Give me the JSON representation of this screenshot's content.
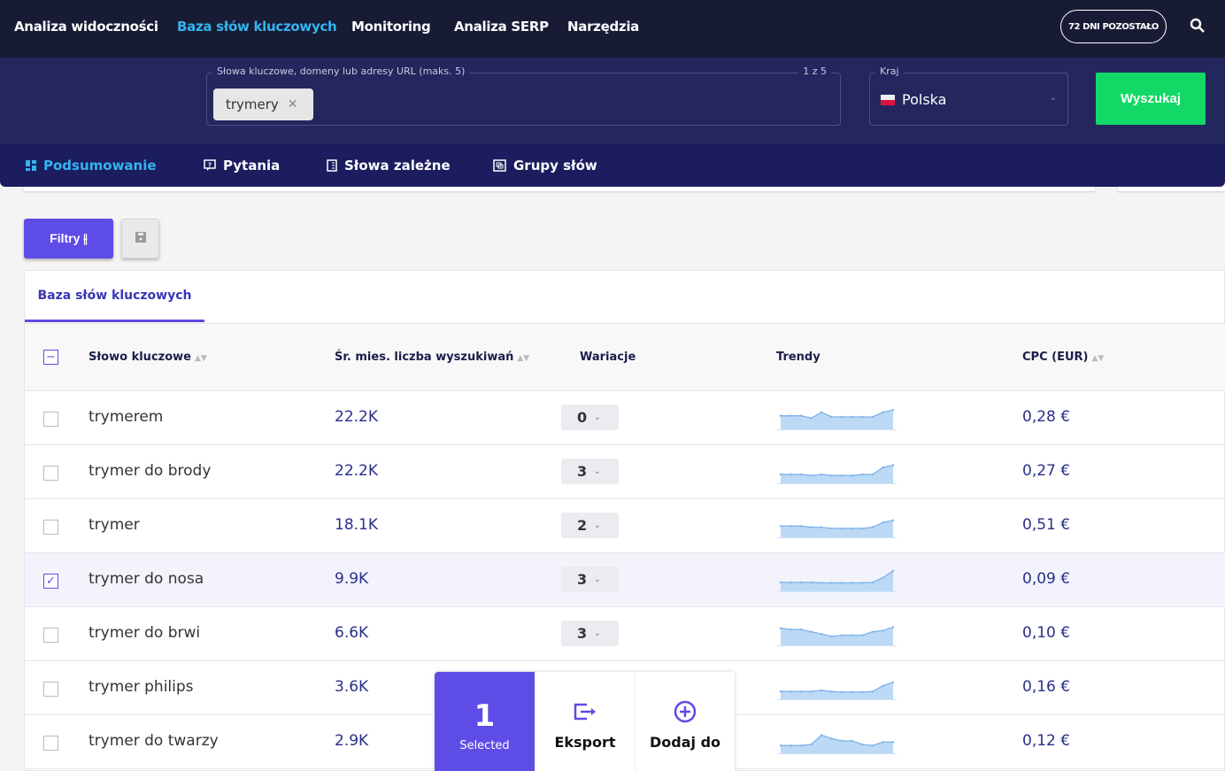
{
  "nav": {
    "items": [
      "Analiza widoczności",
      "Baza słów kluczowych",
      "Monitoring",
      "Analiza SERP",
      "Narzędzia"
    ],
    "active": 1,
    "days_badge": "72 DNI POZOSTAŁO"
  },
  "search": {
    "label": "Słowa kluczowe, domeny lub adresy URL (maks. 5)",
    "counter": "1 z 5",
    "chip": "trymery",
    "country_label": "Kraj",
    "country": "Polska",
    "button": "Wyszukaj"
  },
  "tabs": [
    {
      "label": "Podsumowanie",
      "icon": "dashboard-icon"
    },
    {
      "label": "Pytania",
      "icon": "question-icon"
    },
    {
      "label": "Słowa zależne",
      "icon": "document-icon"
    },
    {
      "label": "Grupy słów",
      "icon": "group-icon"
    }
  ],
  "toolbar": {
    "filters": "Filtry"
  },
  "card_tab": "Baza słów kluczowych",
  "columns": [
    "Słowo kluczowe",
    "Śr. mies. liczba wyszukiwań",
    "Wariacje",
    "Trendy",
    "CPC (EUR)"
  ],
  "rows": [
    {
      "keyword": "trymerem",
      "volume": "22.2K",
      "variations": "0",
      "cpc": "0,28 €",
      "selected": false,
      "trend": [
        55,
        55,
        55,
        45,
        70,
        50,
        50,
        50,
        50,
        50,
        70,
        80
      ]
    },
    {
      "keyword": "trymer do brody",
      "volume": "22.2K",
      "variations": "3",
      "cpc": "0,27 €",
      "selected": false,
      "trend": [
        35,
        35,
        35,
        30,
        35,
        30,
        30,
        30,
        35,
        35,
        65,
        75
      ]
    },
    {
      "keyword": "trymer",
      "volume": "18.1K",
      "variations": "2",
      "cpc": "0,51 €",
      "selected": false,
      "trend": [
        45,
        45,
        45,
        40,
        40,
        35,
        35,
        35,
        35,
        40,
        60,
        70
      ]
    },
    {
      "keyword": "trymer do nosa",
      "volume": "9.9K",
      "variations": "3",
      "cpc": "0,09 €",
      "selected": true,
      "trend": [
        35,
        35,
        35,
        35,
        33,
        33,
        33,
        33,
        33,
        35,
        55,
        85
      ]
    },
    {
      "keyword": "trymer do brwi",
      "volume": "6.6K",
      "variations": "3",
      "cpc": "0,10 €",
      "selected": false,
      "trend": [
        70,
        65,
        65,
        55,
        45,
        35,
        40,
        40,
        40,
        55,
        60,
        75
      ]
    },
    {
      "keyword": "trymer philips",
      "volume": "3.6K",
      "variations": "",
      "cpc": "0,16 €",
      "selected": false,
      "trend": [
        30,
        30,
        30,
        30,
        35,
        30,
        28,
        28,
        28,
        30,
        55,
        70
      ]
    },
    {
      "keyword": "trymer do twarzy",
      "volume": "2.9K",
      "variations": "",
      "cpc": "0,12 €",
      "selected": false,
      "trend": [
        30,
        30,
        30,
        35,
        75,
        60,
        50,
        50,
        35,
        30,
        45,
        45
      ]
    }
  ],
  "bulk": {
    "count": "1",
    "selected_label": "Selected",
    "export": "Eksport",
    "add": "Dodaj do"
  },
  "colors": {
    "accent": "#5e4ce6",
    "nav_active": "#33b5f0",
    "search_button": "#12d865",
    "trend_fill": "#bcd9f5",
    "trend_line": "#7fb3ea"
  }
}
